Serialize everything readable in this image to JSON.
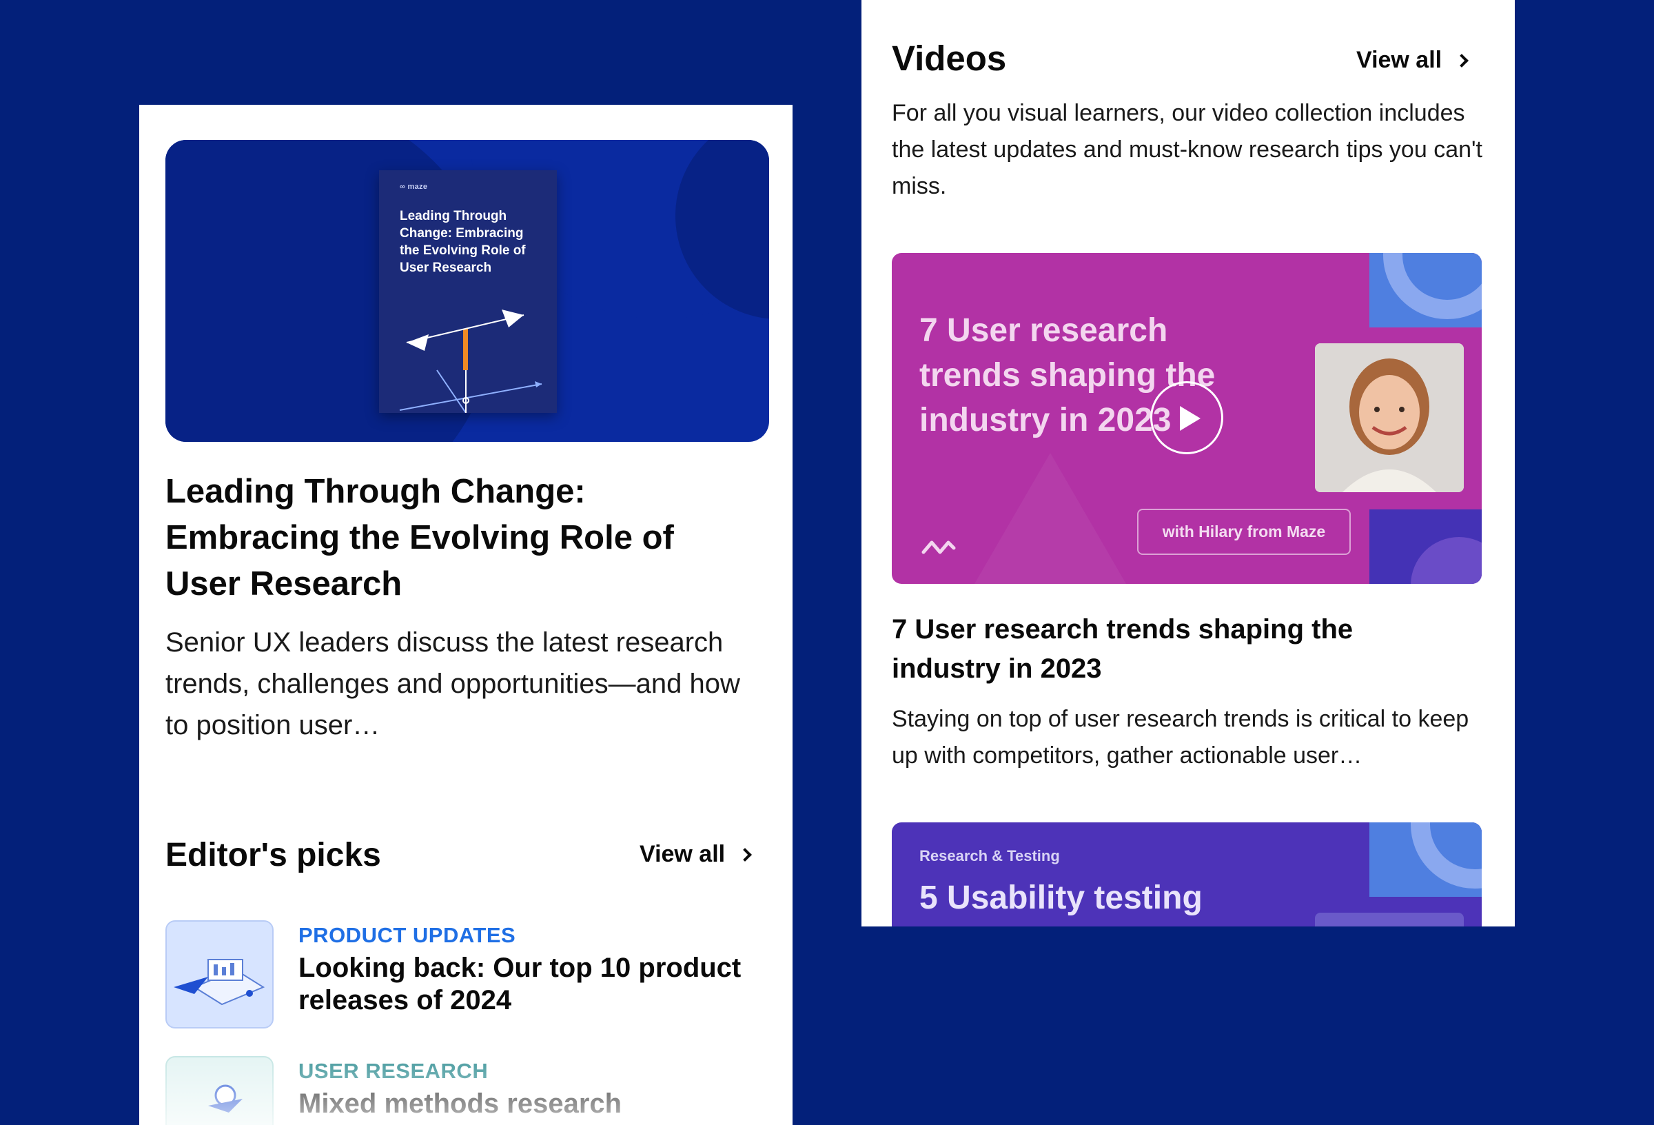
{
  "left": {
    "hero": {
      "logo": "maze",
      "cover_title": "Leading Through Change: Embracing the Evolving Role of User Research"
    },
    "article": {
      "title": "Leading Through Change: Embracing the Evolving Role of User Research",
      "description": "Senior UX leaders discuss the latest research trends, challenges and opportunities—and how to position user…"
    },
    "editors_picks": {
      "title": "Editor's picks",
      "view_all": "View all",
      "items": [
        {
          "category": "PRODUCT UPDATES",
          "category_color": "#1f6fe5",
          "title": "Looking back: Our top 10 product releases of 2024"
        },
        {
          "category": "USER RESEARCH",
          "category_color": "#2a8a8f",
          "title": "Mixed methods research explained:"
        }
      ]
    }
  },
  "right": {
    "videos": {
      "title": "Videos",
      "view_all": "View all",
      "description": "For all you visual learners, our video collection includes the latest updates and must-know research tips you can't miss."
    },
    "video1": {
      "thumb_headline": "7 User research trends shaping the industry in 2023",
      "thumb_caption": "with Hilary from Maze",
      "title": "7 User research trends shaping the industry in 2023",
      "description": "Staying on top of user research trends is critical to keep up with competitors, gather actionable user…"
    },
    "video2": {
      "thumb_category": "Research & Testing",
      "thumb_headline": "5 Usability testing"
    }
  },
  "colors": {
    "background": "#03207a",
    "video_pink": "#b232a5",
    "video_purple": "#4d33b8"
  }
}
